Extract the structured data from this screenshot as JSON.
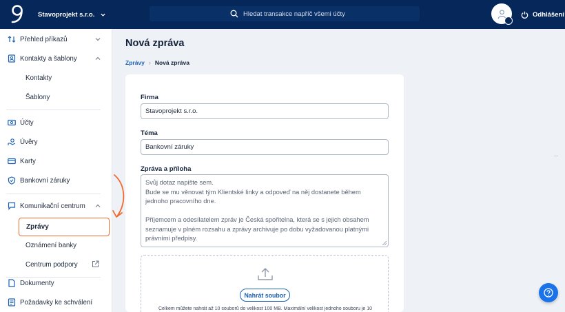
{
  "header": {
    "company": "Stavoprojekt s.r.o.",
    "search_placeholder": "Hledat transakce napříč všemi účty",
    "logout": "Odhlášení"
  },
  "sidebar": {
    "items": [
      {
        "label": "Přehled příkazů",
        "icon": "transfer-arrows-icon"
      },
      {
        "label": "Kontakty a šablony",
        "icon": "contacts-icon"
      },
      {
        "label": "Kontakty"
      },
      {
        "label": "Šablony"
      },
      {
        "label": "Účty",
        "icon": "wallet-icon"
      },
      {
        "label": "Úvěry",
        "icon": "loan-icon"
      },
      {
        "label": "Karty",
        "icon": "card-icon"
      },
      {
        "label": "Bankovní záruky",
        "icon": "shield-icon"
      },
      {
        "label": "Komunikační centrum",
        "icon": "chat-icon"
      },
      {
        "label": "Zprávy"
      },
      {
        "label": "Oznámení banky"
      },
      {
        "label": "Centrum podpory",
        "icon": "external-link-icon"
      },
      {
        "label": "Dokumenty",
        "icon": "document-icon"
      },
      {
        "label": "Požadavky ke schválení",
        "icon": "checklist-icon"
      }
    ]
  },
  "main": {
    "title": "Nová zpráva",
    "breadcrumb": {
      "parent": "Zprávy",
      "current": "Nová zpráva"
    },
    "form": {
      "firma_label": "Firma",
      "firma_value": "Stavoprojekt s.r.o.",
      "tema_label": "Téma",
      "tema_value": "Bankovní záruky",
      "zprava_label": "Zpráva a příloha",
      "zprava_lines": [
        "Svůj dotaz napište sem.",
        "Bude se mu věnovat tým Klientské linky a odpoveď na něj dostanete během",
        "jednoho pracovního dne.",
        "Příjemcem a odesílatelem zpráv je Česká spořitelna, která se s jejich obsahem",
        "seznamuje v plném rozsahu a zprávy archivuje po dobu vyžadovanou platnými",
        "právními předpisy."
      ],
      "upload_button": "Nahrát soubor",
      "upload_note": "Celkem můžete nahrát až 10 souborů do velikost 100 MB. Maximální velikost jednoho souboru je 10"
    }
  },
  "colors": {
    "topbar": "#05275a",
    "accent": "#1a5fb4",
    "highlight": "#f06b2f",
    "help": "#1a73e8"
  }
}
